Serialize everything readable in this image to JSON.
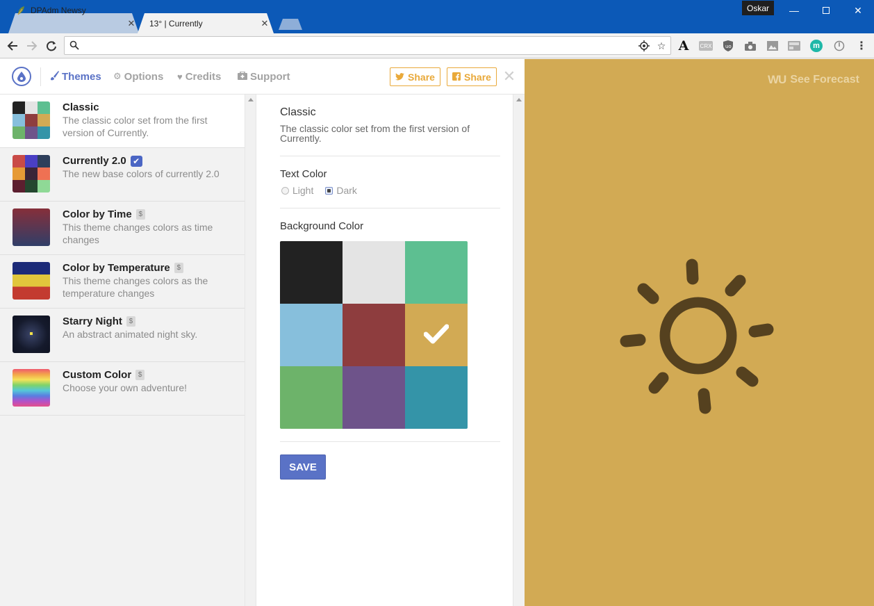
{
  "browser": {
    "tabs": [
      {
        "title": "DPAdm Newsy",
        "active": false
      },
      {
        "title": "13° | Currently",
        "active": true
      }
    ],
    "profile_name": "Oskar",
    "address_bar": {
      "value": "",
      "placeholder": ""
    },
    "extensions": [
      "font-icon",
      "crx-icon",
      "ublock-icon",
      "camera-icon",
      "image-icon",
      "cast-icon",
      "m-icon",
      "power-icon"
    ]
  },
  "header": {
    "nav": [
      {
        "label": "Themes",
        "icon": "brush-icon",
        "active": true
      },
      {
        "label": "Options",
        "icon": "gear-icon",
        "active": false
      },
      {
        "label": "Credits",
        "icon": "heart-icon",
        "active": false
      },
      {
        "label": "Support",
        "icon": "medkit-icon",
        "active": false
      }
    ],
    "share_twitter": "Share",
    "share_facebook": "Share",
    "accent_color": "#5a72c6",
    "share_color": "#e9a93a"
  },
  "themes": [
    {
      "title": "Classic",
      "description": "The classic color set from the first version of Currently.",
      "badge": "",
      "selected": true
    },
    {
      "title": "Currently 2.0",
      "description": "The new base colors of currently 2.0",
      "badge": "check",
      "selected": false
    },
    {
      "title": "Color by Time",
      "description": "This theme changes colors as time changes",
      "badge": "$",
      "selected": false
    },
    {
      "title": "Color by Temperature",
      "description": "This theme changes colors as the temperature changes",
      "badge": "$",
      "selected": false
    },
    {
      "title": "Starry Night",
      "description": "An abstract animated night sky.",
      "badge": "$",
      "selected": false
    },
    {
      "title": "Custom Color",
      "description": "Choose your own adventure!",
      "badge": "$",
      "selected": false
    }
  ],
  "detail": {
    "title": "Classic",
    "description": "The classic color set from the first version of Currently.",
    "text_color_label": "Text Color",
    "text_color_options": [
      {
        "label": "Light",
        "checked": false
      },
      {
        "label": "Dark",
        "checked": true
      }
    ],
    "background_label": "Background Color",
    "swatches": [
      "#222222",
      "#e4e4e4",
      "#5dbf91",
      "#87bfdc",
      "#8e3d3e",
      "#d2aa54",
      "#6db36a",
      "#6e538a",
      "#3494a8"
    ],
    "selected_swatch": 5,
    "save_label": "SAVE"
  },
  "preview": {
    "background": "#d2aa54",
    "forecast_brand": "WU",
    "forecast_label": "See Forecast",
    "icon": "sun-icon"
  }
}
